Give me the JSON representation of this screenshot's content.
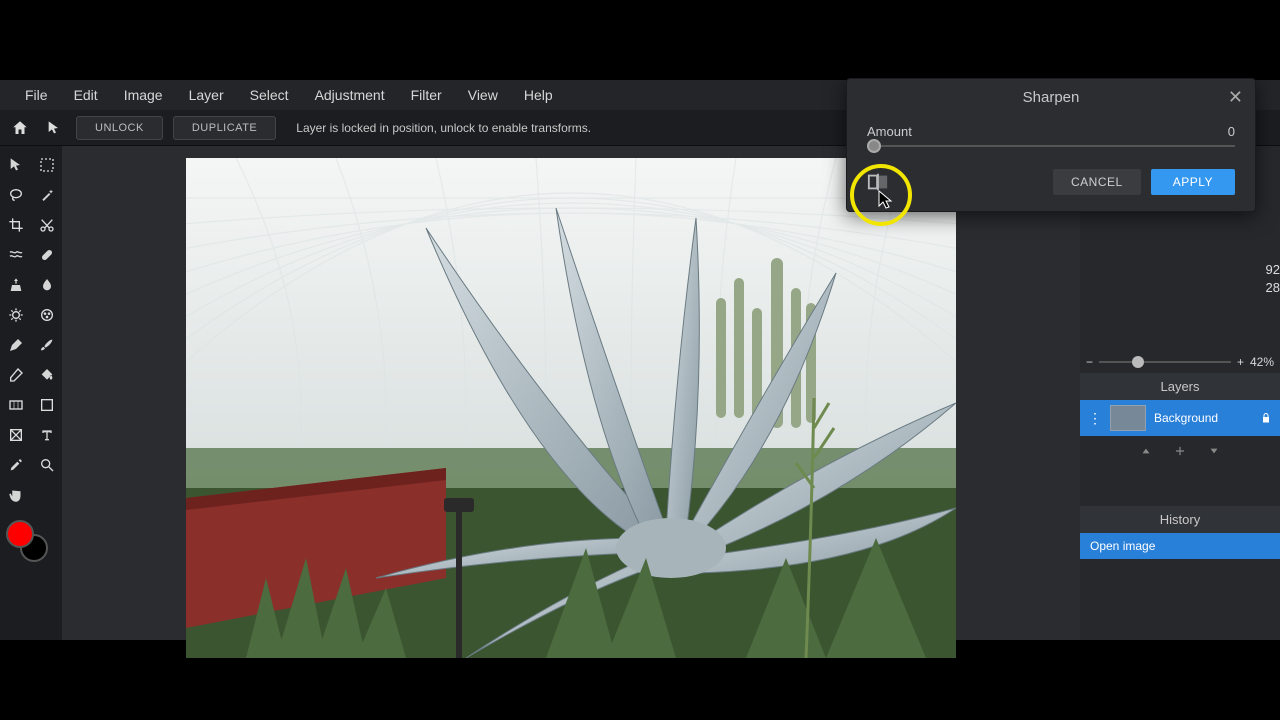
{
  "menu": {
    "items": [
      "File",
      "Edit",
      "Image",
      "Layer",
      "Select",
      "Adjustment",
      "Filter",
      "View",
      "Help"
    ]
  },
  "toolbar": {
    "unlock": "UNLOCK",
    "duplicate": "DUPLICATE",
    "message": "Layer is locked in position, unlock to enable transforms."
  },
  "popover": {
    "title": "Sharpen",
    "amount_label": "Amount",
    "amount_value": "0",
    "cancel": "CANCEL",
    "apply": "APPLY"
  },
  "right": {
    "zoom_value": "42%",
    "layers_header": "Layers",
    "layer_name": "Background",
    "history_header": "History",
    "history_item": "Open image",
    "edge1": "92",
    "edge2": "28"
  },
  "swatch": {
    "fg": "#ff0000",
    "bg": "#000000"
  }
}
